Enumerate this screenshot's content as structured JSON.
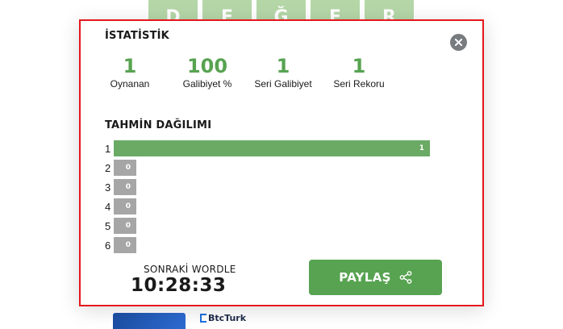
{
  "background": {
    "tiles": [
      "D",
      "E",
      "Ğ",
      "E",
      "R"
    ],
    "ad_brand": "BtcTurk"
  },
  "modal": {
    "close_icon": "close-icon",
    "stats_title": "İSTATİSTİK",
    "stats": [
      {
        "value": "1",
        "label": "Oynanan"
      },
      {
        "value": "100",
        "label": "Galibiyet %"
      },
      {
        "value": "1",
        "label": "Seri Galibiyet"
      },
      {
        "value": "1",
        "label": "Seri Rekoru"
      }
    ],
    "distribution_title": "TAHMİN DAĞILIMI",
    "distribution": [
      {
        "guess": "1",
        "count": 1,
        "count_label": "1",
        "highlight": true
      },
      {
        "guess": "2",
        "count": 0,
        "count_label": "0",
        "highlight": false
      },
      {
        "guess": "3",
        "count": 0,
        "count_label": "0",
        "highlight": false
      },
      {
        "guess": "4",
        "count": 0,
        "count_label": "0",
        "highlight": false
      },
      {
        "guess": "5",
        "count": 0,
        "count_label": "0",
        "highlight": false
      },
      {
        "guess": "6",
        "count": 0,
        "count_label": "0",
        "highlight": false
      }
    ],
    "next_wordle_label": "SONRAKİ WORDLE",
    "countdown": "10:28:33",
    "share_label": "PAYLAŞ",
    "share_icon": "share-icon"
  },
  "colors": {
    "accent_green": "#58a351",
    "bar_gray": "#a6a6a6",
    "border_red": "#e5171c",
    "close_gray": "#787c7e"
  }
}
